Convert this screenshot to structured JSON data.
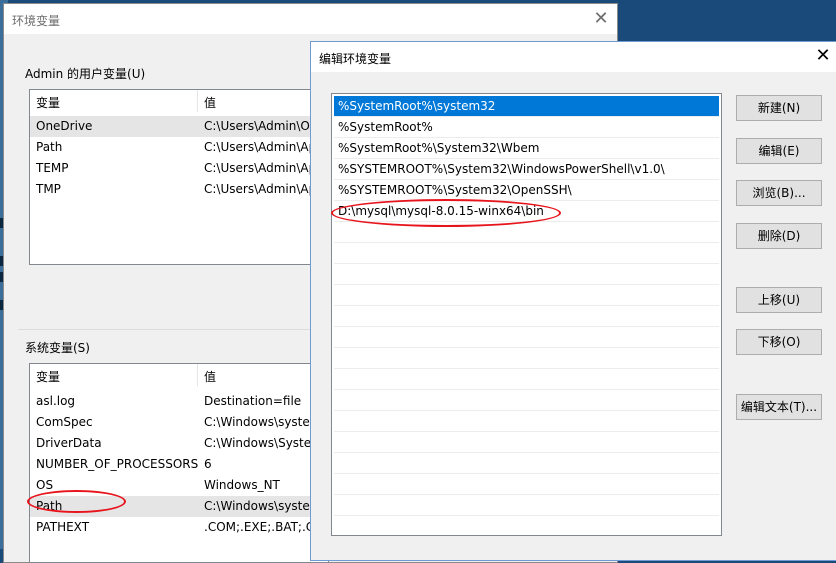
{
  "env_dialog": {
    "title": "环境变量",
    "close_glyph": "✕",
    "user_vars": {
      "group_label": "Admin 的用户变量(U)",
      "col_var": "变量",
      "col_val": "值",
      "rows": [
        {
          "name": "OneDrive",
          "value": "C:\\Users\\Admin\\O"
        },
        {
          "name": "Path",
          "value": "C:\\Users\\Admin\\Ap"
        },
        {
          "name": "TEMP",
          "value": "C:\\Users\\Admin\\Ap"
        },
        {
          "name": "TMP",
          "value": "C:\\Users\\Admin\\Ap"
        }
      ]
    },
    "system_vars": {
      "group_label": "系统变量(S)",
      "col_var": "变量",
      "col_val": "值",
      "rows": [
        {
          "name": "asl.log",
          "value": "Destination=file"
        },
        {
          "name": "ComSpec",
          "value": "C:\\Windows\\syster"
        },
        {
          "name": "DriverData",
          "value": "C:\\Windows\\Syster"
        },
        {
          "name": "NUMBER_OF_PROCESSORS",
          "value": "6"
        },
        {
          "name": "OS",
          "value": "Windows_NT"
        },
        {
          "name": "Path",
          "value": "C:\\Windows\\syster"
        },
        {
          "name": "PATHEXT",
          "value": ".COM;.EXE;.BAT;.CI"
        }
      ]
    }
  },
  "edit_dialog": {
    "title": "编辑环境变量",
    "close_glyph": "✕",
    "entries": [
      "%SystemRoot%\\system32",
      "%SystemRoot%",
      "%SystemRoot%\\System32\\Wbem",
      "%SYSTEMROOT%\\System32\\WindowsPowerShell\\v1.0\\",
      "%SYSTEMROOT%\\System32\\OpenSSH\\",
      "D:\\mysql\\mysql-8.0.15-winx64\\bin"
    ],
    "buttons": {
      "new": "新建(N)",
      "edit": "编辑(E)",
      "browse": "浏览(B)...",
      "delete": "删除(D)",
      "move_up": "上移(U)",
      "move_down": "下移(O)",
      "edit_text": "编辑文本(T)..."
    }
  },
  "colors": {
    "selection": "#0078d7",
    "annotation": "#e8141c"
  }
}
